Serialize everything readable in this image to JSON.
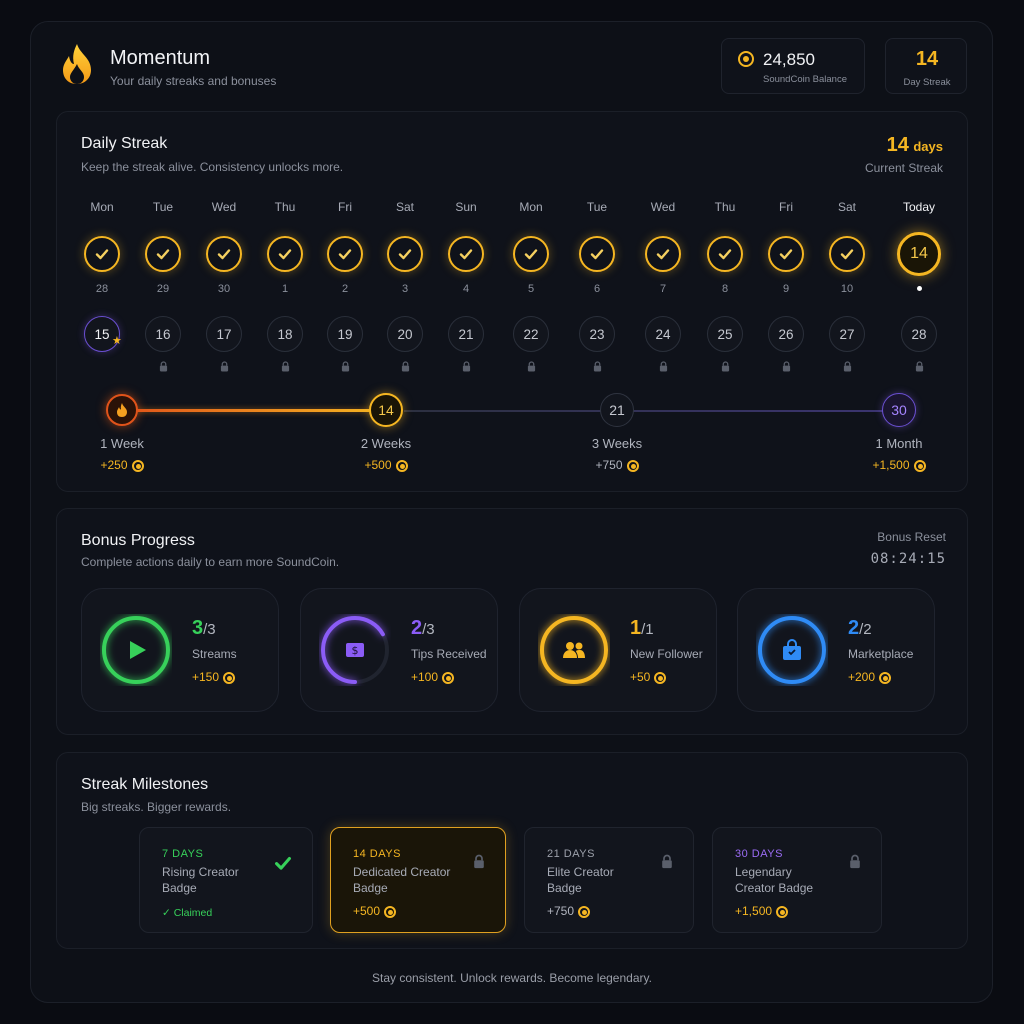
{
  "header": {
    "title": "Momentum",
    "subtitle": "Your daily streaks and bonuses",
    "balance_value": "24,850",
    "balance_label": "SoundCoin Balance",
    "streak_value": "14",
    "streak_label": "Day Streak"
  },
  "daily_streak": {
    "title": "Daily Streak",
    "subtitle": "Keep the streak alive. Consistency unlocks more.",
    "current_value": "14",
    "current_unit": "days",
    "current_label": "Current Streak",
    "week1": [
      {
        "day": "Mon",
        "date": "28"
      },
      {
        "day": "Tue",
        "date": "29"
      },
      {
        "day": "Wed",
        "date": "30"
      },
      {
        "day": "Thu",
        "date": "1"
      },
      {
        "day": "Fri",
        "date": "2"
      },
      {
        "day": "Sat",
        "date": "3"
      },
      {
        "day": "Sun",
        "date": "4"
      },
      {
        "day": "Mon",
        "date": "5"
      },
      {
        "day": "Tue",
        "date": "6"
      },
      {
        "day": "Wed",
        "date": "7"
      },
      {
        "day": "Thu",
        "date": "8"
      },
      {
        "day": "Fri",
        "date": "9"
      },
      {
        "day": "Sat",
        "date": "10"
      },
      {
        "day": "Today",
        "date": "14"
      }
    ],
    "upcoming": [
      "15",
      "16",
      "17",
      "18",
      "19",
      "20",
      "21",
      "22",
      "23",
      "24",
      "25",
      "26",
      "27",
      "28"
    ],
    "milestones": [
      {
        "node": "",
        "label": "1 Week",
        "reward": "+250"
      },
      {
        "node": "14",
        "label": "2 Weeks",
        "reward": "+500"
      },
      {
        "node": "21",
        "label": "3 Weeks",
        "reward": "+750"
      },
      {
        "node": "30",
        "label": "1 Month",
        "reward": "+1,500"
      }
    ]
  },
  "bonus": {
    "title": "Bonus Progress",
    "subtitle": "Complete actions daily to earn more SoundCoin.",
    "reset_label": "Bonus Reset",
    "reset_time": "08:24:15",
    "cards": [
      {
        "done": "3",
        "total": "/3",
        "name": "Streams",
        "reward": "+150",
        "color": "#37d15a",
        "progress": 1.0,
        "icon": "play-icon"
      },
      {
        "done": "2",
        "total": "/3",
        "name": "Tips Received",
        "reward": "+100",
        "color": "#8b5cf6",
        "progress": 0.667,
        "icon": "money-icon"
      },
      {
        "done": "1",
        "total": "/1",
        "name": "New Follower",
        "reward": "+50",
        "color": "#f5b622",
        "progress": 1.0,
        "icon": "users-icon"
      },
      {
        "done": "2",
        "total": "/2",
        "name": "Marketplace",
        "reward": "+200",
        "color": "#2f8bf5",
        "progress": 1.0,
        "icon": "shopping-bag-icon"
      }
    ]
  },
  "streak_milestones": {
    "title": "Streak Milestones",
    "subtitle": "Big streaks. Bigger rewards.",
    "items": [
      {
        "days": "7 DAYS",
        "name": "Rising Creator Badge",
        "reward": "✓ Claimed",
        "color": "#37d15a",
        "state": "claimed"
      },
      {
        "days": "14 DAYS",
        "name": "Dedicated Creator Badge",
        "reward": "+500",
        "color": "#f5b622",
        "state": "active"
      },
      {
        "days": "21 DAYS",
        "name": "Elite Creator Badge",
        "reward": "+750",
        "color": "#9ca0aa",
        "state": "locked"
      },
      {
        "days": "30 DAYS",
        "name": "Legendary Creator Badge",
        "reward": "+1,500",
        "color": "#9b6cf5",
        "state": "locked"
      }
    ]
  },
  "footer": "Stay consistent.  Unlock rewards.  Become legendary."
}
